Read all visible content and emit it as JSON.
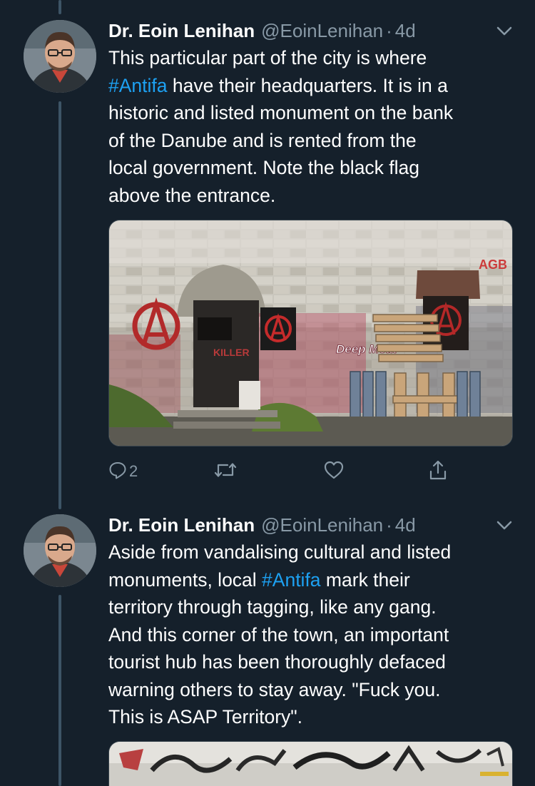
{
  "tweets": [
    {
      "author_name": "Dr. Eoin Lenihan",
      "handle": "@EoinLenihan",
      "separator": "·",
      "time": "4d",
      "lines": [
        {
          "before": "This particular part of the city is where",
          "hashtag": "",
          "after": ""
        },
        {
          "before": "",
          "hashtag": "#Antifa",
          "after": " have their headquarters. It is in a"
        },
        {
          "before": "historic and listed monument on the bank",
          "hashtag": "",
          "after": ""
        },
        {
          "before": "of the Danube and is rented from the",
          "hashtag": "",
          "after": ""
        },
        {
          "before": "local government. Note the black flag",
          "hashtag": "",
          "after": ""
        },
        {
          "before": "above the entrance.",
          "hashtag": "",
          "after": ""
        }
      ],
      "media": {
        "graffiti_top_right": "AGB",
        "graffiti_door": "KILLER",
        "graffiti_wall": "Deep Meat"
      },
      "actions": {
        "reply_count": "2",
        "retweet_count": "",
        "like_count": ""
      }
    },
    {
      "author_name": "Dr. Eoin Lenihan",
      "handle": "@EoinLenihan",
      "separator": "·",
      "time": "4d",
      "lines": [
        {
          "before": "Aside from vandalising cultural and listed",
          "hashtag": "",
          "after": ""
        },
        {
          "before": "monuments, local ",
          "hashtag": "#Antifa",
          "after": " mark their"
        },
        {
          "before": "territory through tagging, like any gang.",
          "hashtag": "",
          "after": ""
        },
        {
          "before": "And this corner of the town, an important",
          "hashtag": "",
          "after": ""
        },
        {
          "before": "tourist hub has been thoroughly defaced",
          "hashtag": "",
          "after": ""
        },
        {
          "before": "warning others to stay away. \"Fuck you.",
          "hashtag": "",
          "after": ""
        },
        {
          "before": "This is ASAP Territory\".",
          "hashtag": "",
          "after": ""
        }
      ]
    }
  ],
  "colors": {
    "background": "#15202b",
    "text": "#ffffff",
    "secondary": "#8899a6",
    "link": "#1da1f2",
    "thread_line": "#3d5466"
  },
  "icons": [
    "chevron-down-icon",
    "reply-icon",
    "retweet-icon",
    "like-icon",
    "share-icon"
  ]
}
